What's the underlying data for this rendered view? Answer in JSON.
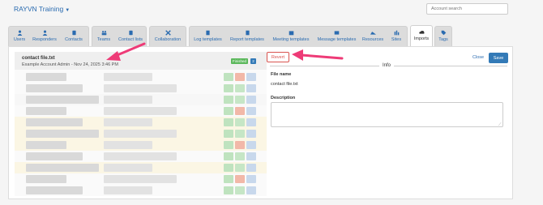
{
  "header": {
    "org_name": "RAYVN Training",
    "search_placeholder": "Account search"
  },
  "tabs": [
    {
      "label": "Users",
      "icon": "user-icon"
    },
    {
      "label": "Responders",
      "icon": "responders-icon"
    },
    {
      "label": "Contacts",
      "icon": "contacts-icon"
    },
    {
      "label": "Teams",
      "icon": "teams-icon"
    },
    {
      "label": "Contact lists",
      "icon": "contact-lists-icon"
    },
    {
      "label": "Collaboration",
      "icon": "collaboration-icon"
    },
    {
      "label": "Log templates",
      "icon": "log-templates-icon"
    },
    {
      "label": "Report templates",
      "icon": "report-templates-icon"
    },
    {
      "label": "Meeting templates",
      "icon": "meeting-templates-icon"
    },
    {
      "label": "Message templates",
      "icon": "message-templates-icon"
    },
    {
      "label": "Resources",
      "icon": "resources-icon"
    },
    {
      "label": "Sites",
      "icon": "sites-icon"
    },
    {
      "label": "Imports",
      "icon": "cloud-upload-icon",
      "active": true
    },
    {
      "label": "Tags",
      "icon": "tag-icon"
    }
  ],
  "import_file": {
    "name": "contact file.txt",
    "meta": "Example Account Admin - Nov 24, 2025 3:46 PM",
    "status": "Finished",
    "count": "2"
  },
  "detail": {
    "revert_label": "Revert",
    "close_label": "Close",
    "save_label": "Save",
    "section_title": "Info",
    "file_name_label": "File name",
    "file_name_value": "contact file.txt",
    "description_label": "Description",
    "description_value": ""
  },
  "colors": {
    "accent": "#337ab7",
    "link": "#2a6bb0",
    "revert": "#d9534f",
    "finished": "#5cb85c",
    "annotation_arrow": "#ee3b77"
  }
}
